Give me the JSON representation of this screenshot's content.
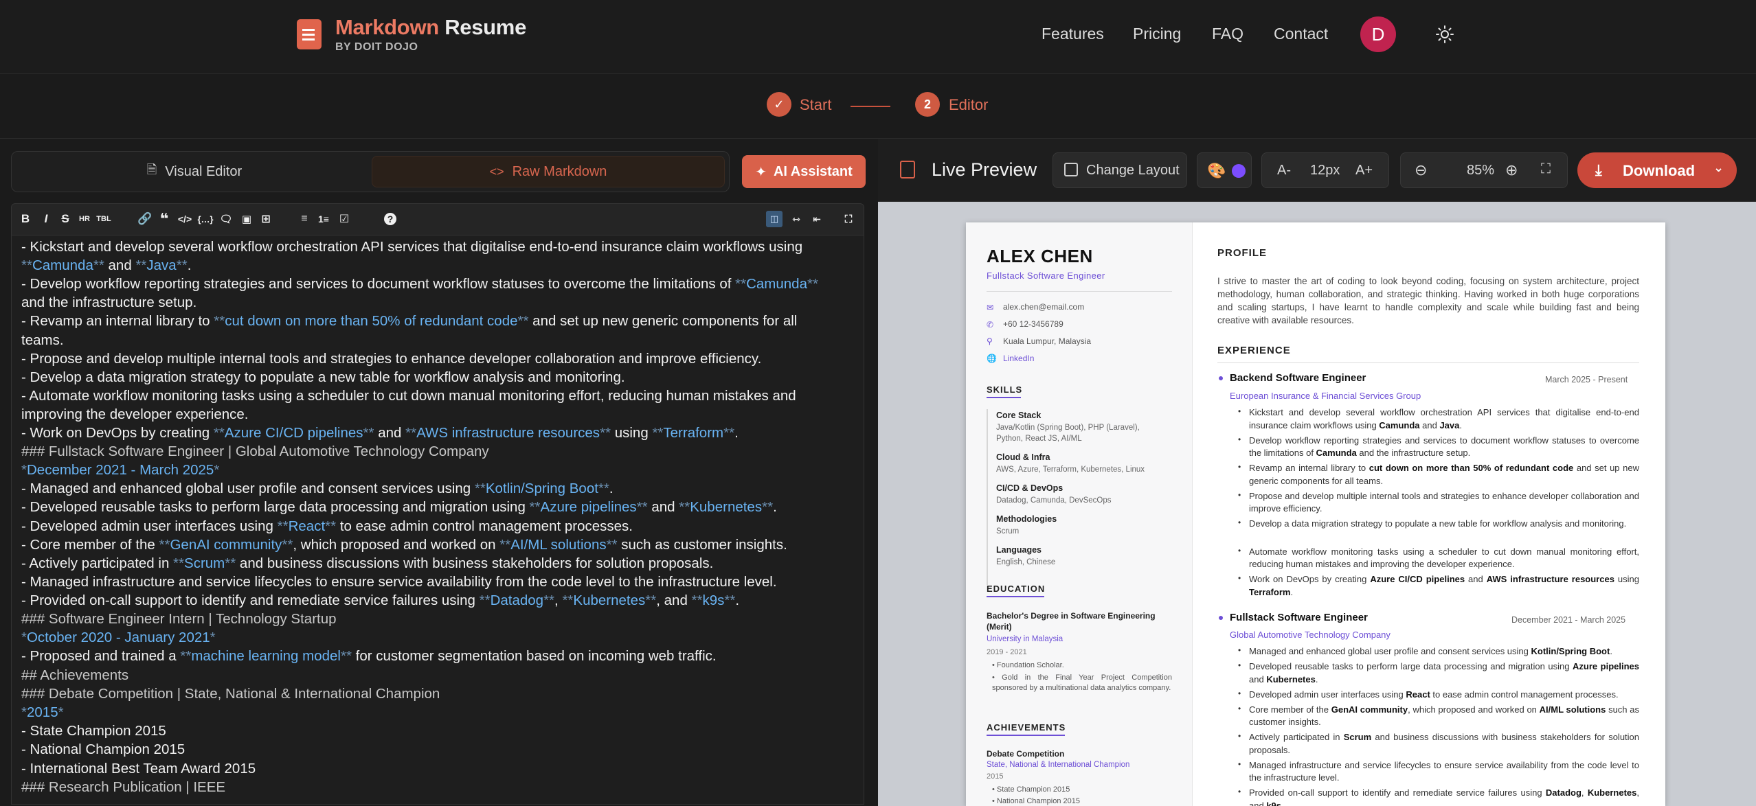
{
  "header": {
    "logo_word1": "Markdown",
    "logo_word2": " Resume",
    "logo_sub": "BY DOIT DOJO",
    "nav": [
      "Features",
      "Pricing",
      "FAQ",
      "Contact"
    ],
    "avatar_letter": "D"
  },
  "stepper": {
    "step1_label": "Start",
    "step2_number": "2",
    "step2_label": "Editor"
  },
  "editor": {
    "tab_visual": "Visual Editor",
    "tab_raw": "Raw Markdown",
    "ai_button": "AI Assistant",
    "lines": [
      [
        [
          "t",
          "- Kickstart and develop several workflow orchestration API services that digitalise end-to-end insurance claim workflows using"
        ]
      ],
      [
        [
          "m",
          "**"
        ],
        [
          "h",
          "Camunda"
        ],
        [
          "m",
          "**"
        ],
        [
          "t",
          " and "
        ],
        [
          "m",
          "**"
        ],
        [
          "h",
          "Java"
        ],
        [
          "m",
          "**"
        ],
        [
          "t",
          "."
        ]
      ],
      [
        [
          "t",
          "- Develop workflow reporting strategies and services to document workflow statuses to overcome the limitations of "
        ],
        [
          "m",
          "**"
        ],
        [
          "h",
          "Camunda"
        ],
        [
          "m",
          "**"
        ]
      ],
      [
        [
          "t",
          "and the infrastructure setup."
        ]
      ],
      [
        [
          "t",
          "- Revamp an internal library to "
        ],
        [
          "m",
          "**"
        ],
        [
          "h",
          "cut down on more than 50% of redundant code"
        ],
        [
          "m",
          "**"
        ],
        [
          "t",
          " and set up new generic components for all"
        ]
      ],
      [
        [
          "t",
          "teams."
        ]
      ],
      [
        [
          "t",
          "- Propose and develop multiple internal tools and strategies to enhance developer collaboration and improve efficiency."
        ]
      ],
      [
        [
          "t",
          "- Develop a data migration strategy to populate a new table for workflow analysis and monitoring."
        ]
      ],
      [
        [
          "t",
          "- Automate workflow monitoring tasks using a scheduler to cut down manual monitoring effort, reducing human mistakes and"
        ]
      ],
      [
        [
          "t",
          "improving the developer experience."
        ]
      ],
      [
        [
          "t",
          "- Work on DevOps by creating "
        ],
        [
          "m",
          "**"
        ],
        [
          "h",
          "Azure CI/CD pipelines"
        ],
        [
          "m",
          "**"
        ],
        [
          "t",
          " and "
        ],
        [
          "m",
          "**"
        ],
        [
          "h",
          "AWS infrastructure resources"
        ],
        [
          "m",
          "**"
        ],
        [
          "t",
          " using "
        ],
        [
          "m",
          "**"
        ],
        [
          "h",
          "Terraform"
        ],
        [
          "m",
          "**"
        ],
        [
          "t",
          "."
        ]
      ],
      [
        [
          "d",
          "### Fullstack Software Engineer | Global Automotive Technology Company"
        ]
      ],
      [
        [
          "m",
          "*"
        ],
        [
          "h",
          "December 2021 - March 2025"
        ],
        [
          "m",
          "*"
        ]
      ],
      [
        [
          "t",
          "- Managed and enhanced global user profile and consent services using "
        ],
        [
          "m",
          "**"
        ],
        [
          "h",
          "Kotlin/Spring Boot"
        ],
        [
          "m",
          "**"
        ],
        [
          "t",
          "."
        ]
      ],
      [
        [
          "t",
          "- Developed reusable tasks to perform large data processing and migration using "
        ],
        [
          "m",
          "**"
        ],
        [
          "h",
          "Azure pipelines"
        ],
        [
          "m",
          "**"
        ],
        [
          "t",
          " and "
        ],
        [
          "m",
          "**"
        ],
        [
          "h",
          "Kubernetes"
        ],
        [
          "m",
          "**"
        ],
        [
          "t",
          "."
        ]
      ],
      [
        [
          "t",
          "- Developed admin user interfaces using "
        ],
        [
          "m",
          "**"
        ],
        [
          "h",
          "React"
        ],
        [
          "m",
          "**"
        ],
        [
          "t",
          " to ease admin control management processes."
        ]
      ],
      [
        [
          "t",
          "- Core member of the "
        ],
        [
          "m",
          "**"
        ],
        [
          "h",
          "GenAI community"
        ],
        [
          "m",
          "**"
        ],
        [
          "t",
          ", which proposed and worked on "
        ],
        [
          "m",
          "**"
        ],
        [
          "h",
          "AI/ML solutions"
        ],
        [
          "m",
          "**"
        ],
        [
          "t",
          " such as customer insights."
        ]
      ],
      [
        [
          "t",
          "- Actively participated in "
        ],
        [
          "m",
          "**"
        ],
        [
          "h",
          "Scrum"
        ],
        [
          "m",
          "**"
        ],
        [
          "t",
          " and business discussions with business stakeholders for solution proposals."
        ]
      ],
      [
        [
          "t",
          "- Managed infrastructure and service lifecycles to ensure service availability from the code level to the infrastructure level."
        ]
      ],
      [
        [
          "t",
          "- Provided on-call support to identify and remediate service failures using "
        ],
        [
          "m",
          "**"
        ],
        [
          "h",
          "Datadog"
        ],
        [
          "m",
          "**"
        ],
        [
          "t",
          ", "
        ],
        [
          "m",
          "**"
        ],
        [
          "h",
          "Kubernetes"
        ],
        [
          "m",
          "**"
        ],
        [
          "t",
          ", and "
        ],
        [
          "m",
          "**"
        ],
        [
          "h",
          "k9s"
        ],
        [
          "m",
          "**"
        ],
        [
          "t",
          "."
        ]
      ],
      [
        [
          "d",
          "### Software Engineer Intern | Technology Startup"
        ]
      ],
      [
        [
          "m",
          "*"
        ],
        [
          "h",
          "October 2020 - January 2021"
        ],
        [
          "m",
          "*"
        ]
      ],
      [
        [
          "t",
          "- Proposed and trained a "
        ],
        [
          "m",
          "**"
        ],
        [
          "h",
          "machine learning model"
        ],
        [
          "m",
          "**"
        ],
        [
          "t",
          " for customer segmentation based on incoming web traffic."
        ]
      ],
      [
        [
          "d",
          "## Achievements"
        ]
      ],
      [
        [
          "d",
          "### Debate Competition | State, National & International Champion"
        ]
      ],
      [
        [
          "m",
          "*"
        ],
        [
          "h",
          "2015"
        ],
        [
          "m",
          "*"
        ]
      ],
      [
        [
          "t",
          "- State Champion 2015"
        ]
      ],
      [
        [
          "t",
          "- National Champion 2015"
        ]
      ],
      [
        [
          "t",
          "- International Best Team Award 2015"
        ]
      ],
      [
        [
          "d",
          "### Research Publication | IEEE"
        ]
      ]
    ]
  },
  "preview": {
    "title": "Live Preview",
    "change_layout": "Change Layout",
    "font_decrease": "A-",
    "font_size": "12px",
    "font_increase": "A+",
    "zoom": "85%",
    "download": "Download",
    "theme_color": "#7c4dff"
  },
  "resume": {
    "name": "ALEX CHEN",
    "role": "Fullstack Software Engineer",
    "email": "alex.chen@email.com",
    "phone": "+60 12-3456789",
    "location": "Kuala Lumpur, Malaysia",
    "linkedin": "LinkedIn",
    "skills_heading": "SKILLS",
    "skills": [
      {
        "title": "Core Stack",
        "lines": [
          "Java/Kotlin (Spring Boot), PHP (Laravel),",
          "Python, React JS, AI/ML"
        ]
      },
      {
        "title": "Cloud & Infra",
        "lines": [
          "AWS, Azure, Terraform, Kubernetes, Linux"
        ]
      },
      {
        "title": "CI/CD & DevOps",
        "lines": [
          "Datadog, Camunda, DevSecOps"
        ]
      },
      {
        "title": "Methodologies",
        "lines": [
          "Scrum"
        ]
      },
      {
        "title": "Languages",
        "lines": [
          "English, Chinese"
        ]
      }
    ],
    "education_heading": "EDUCATION",
    "edu_degree_1": "Bachelor's Degree in Software Engineering",
    "edu_degree_2": "(Merit)",
    "edu_school": "University in Malaysia",
    "edu_years": "2019 - 2021",
    "edu_b1": "Foundation Scholar.",
    "edu_b2": "Gold in the Final Year Project Competition sponsored by a multinational data analytics company.",
    "achievements_heading": "ACHIEVEMENTS",
    "ach_title": "Debate Competition",
    "ach_sub": "State, National & International Champion",
    "ach_year": "2015",
    "ach_b1": "State Champion 2015",
    "ach_b2": "National Champion 2015",
    "profile_heading": "PROFILE",
    "profile_text": "I strive to master the art of coding to look beyond coding, focusing on system architecture, project methodology, human collaboration, and strategic thinking. Having worked in both huge corporations and scaling startups, I have learnt to handle complexity and scale while building fast and being creative with available resources.",
    "experience_heading": "EXPERIENCE",
    "job1_title": "Backend Software Engineer",
    "job1_dates": "March 2025 - Present",
    "job1_company": "European Insurance & Financial Services Group",
    "job2_title": "Fullstack Software Engineer",
    "job2_dates": "December 2021 - March 2025",
    "job2_company": "Global Automotive Technology Company"
  }
}
